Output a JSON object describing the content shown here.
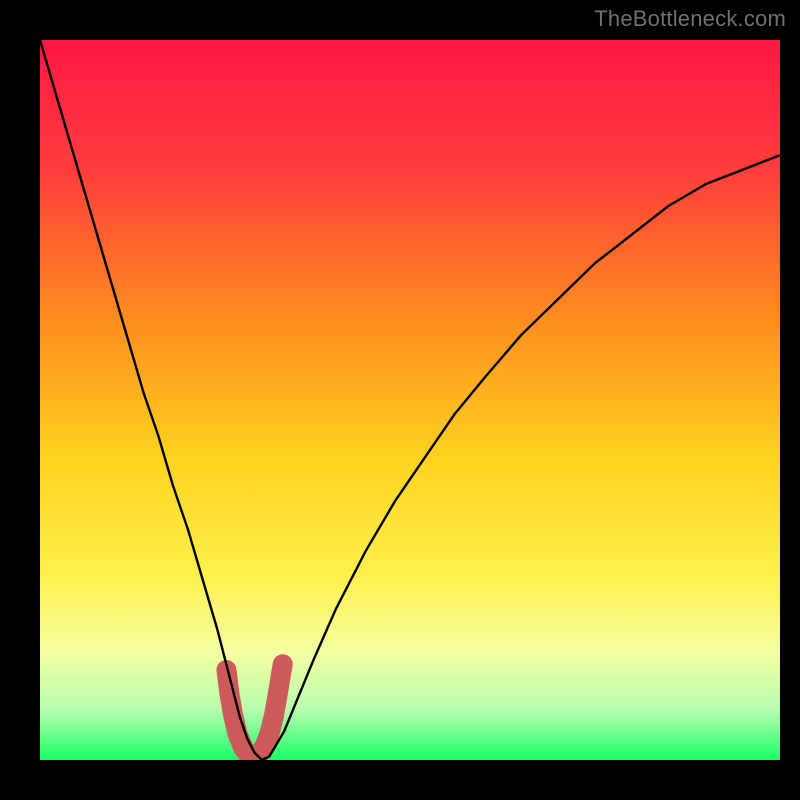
{
  "watermark": {
    "text": "TheBottleneck.com"
  },
  "chart_data": {
    "type": "line",
    "title": "",
    "xlabel": "",
    "ylabel": "",
    "xlim": [
      0,
      100
    ],
    "ylim": [
      0,
      100
    ],
    "series": [
      {
        "name": "main-curve",
        "x": [
          0,
          2,
          4,
          6,
          8,
          10,
          12,
          14,
          16,
          18,
          20,
          22,
          24,
          25,
          26,
          27,
          28,
          29,
          30,
          31,
          33,
          35,
          37,
          40,
          44,
          48,
          52,
          56,
          60,
          65,
          70,
          75,
          80,
          85,
          90,
          95,
          100
        ],
        "y": [
          100,
          93,
          86,
          79,
          72,
          65,
          58,
          51,
          45,
          38,
          32,
          25,
          18,
          14,
          10,
          6,
          3,
          1,
          0,
          0.5,
          4,
          9,
          14,
          21,
          29,
          36,
          42,
          48,
          53,
          59,
          64,
          69,
          73,
          77,
          80,
          82,
          84
        ]
      },
      {
        "name": "highlight-band",
        "x": [
          25.2,
          25.6,
          26.1,
          26.7,
          27.5,
          28.4,
          29.3,
          30.2,
          31.0,
          31.6,
          32.1,
          32.5,
          32.8
        ],
        "y": [
          12.5,
          9.2,
          6.2,
          3.6,
          1.6,
          0.5,
          0.5,
          1.6,
          3.6,
          6.1,
          9.0,
          11.5,
          13.3
        ]
      }
    ],
    "gradient_stops": [
      {
        "offset": 0,
        "color": "#ff1744"
      },
      {
        "offset": 18,
        "color": "#ff3d3d"
      },
      {
        "offset": 38,
        "color": "#ff8a1f"
      },
      {
        "offset": 58,
        "color": "#ffd21f"
      },
      {
        "offset": 74,
        "color": "#fff04a"
      },
      {
        "offset": 85,
        "color": "#f4ffa0"
      },
      {
        "offset": 93,
        "color": "#b8ffb0"
      },
      {
        "offset": 100,
        "color": "#1aff66"
      }
    ],
    "styles": {
      "main_curve": {
        "stroke": "#000000",
        "width": 2.4
      },
      "highlight": {
        "stroke": "#cc5a5a",
        "width": 20,
        "linecap": "round"
      }
    }
  }
}
